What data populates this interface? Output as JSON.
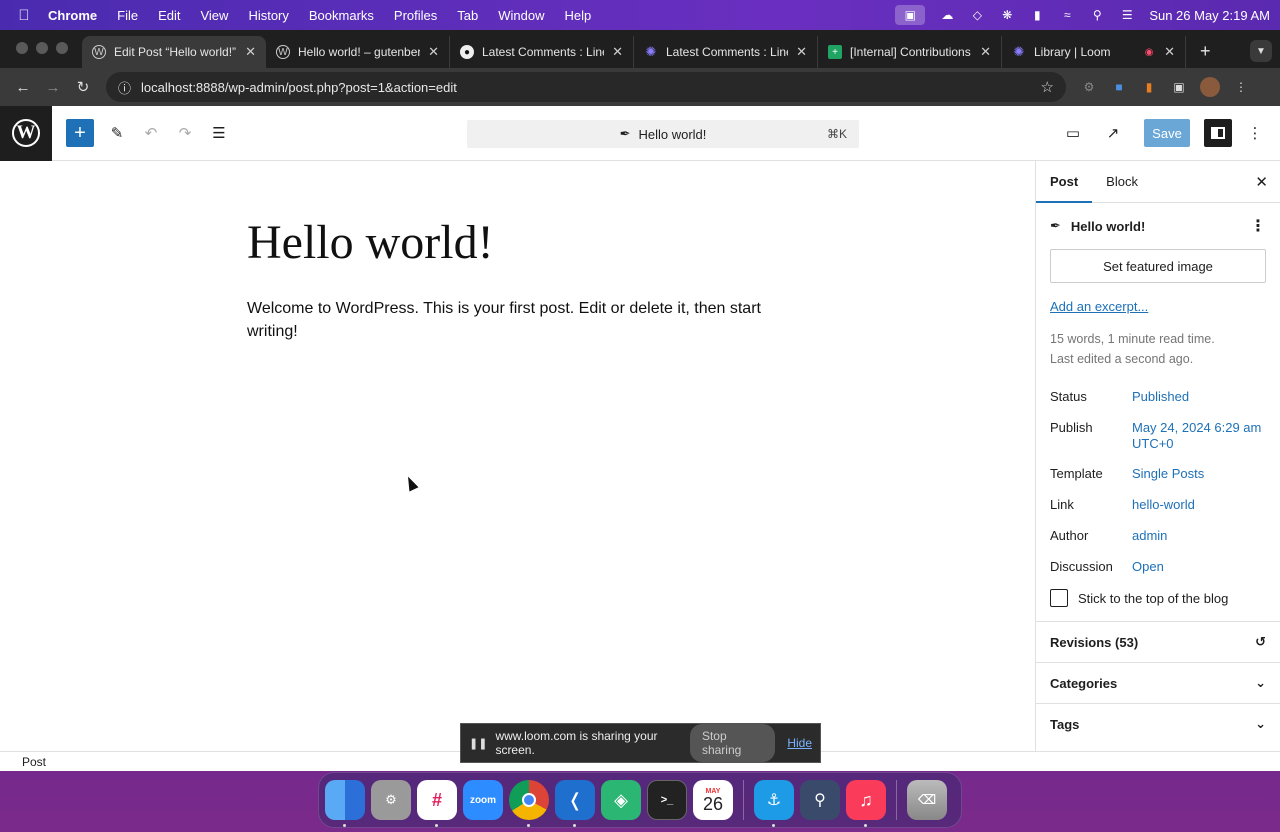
{
  "menubar": {
    "app": "Chrome",
    "items": [
      "File",
      "Edit",
      "View",
      "History",
      "Bookmarks",
      "Profiles",
      "Tab",
      "Window",
      "Help"
    ],
    "clock": "Sun 26 May  2:19 AM"
  },
  "tabs": [
    {
      "title": "Edit Post “Hello world!” ‹",
      "favicon": "wordpress-icon"
    },
    {
      "title": "Hello world! – gutenberg",
      "favicon": "wordpress-icon"
    },
    {
      "title": "Latest Comments : Line",
      "favicon": "github-icon"
    },
    {
      "title": "Latest Comments : Line",
      "favicon": "asterisk-icon"
    },
    {
      "title": "[Internal] Contributions",
      "favicon": "sheets-icon"
    },
    {
      "title": "Library | Loom",
      "favicon": "loom-icon"
    }
  ],
  "toolbar": {
    "url": "localhost:8888/wp-admin/post.php?post=1&action=edit"
  },
  "editor": {
    "command_title": "Hello world!",
    "shortcut": "⌘K",
    "save_label": "Save",
    "post_title": "Hello world!",
    "post_content": "Welcome to WordPress. This is your first post. Edit or delete it, then start writing!"
  },
  "sidebar": {
    "tab_post": "Post",
    "tab_block": "Block",
    "post_name": "Hello world!",
    "featured_image": "Set featured image",
    "excerpt_link": "Add an excerpt...",
    "word_count": "15 words, 1 minute read time.",
    "last_edited": "Last edited a second ago.",
    "fields": [
      {
        "label": "Status",
        "value": "Published"
      },
      {
        "label": "Publish",
        "value": "May 24, 2024 6:29 am UTC+0"
      },
      {
        "label": "Template",
        "value": "Single Posts"
      },
      {
        "label": "Link",
        "value": "hello-world"
      },
      {
        "label": "Author",
        "value": "admin"
      },
      {
        "label": "Discussion",
        "value": "Open"
      }
    ],
    "sticky_label": "Stick to the top of the blog",
    "revisions": "Revisions (53)",
    "categories": "Categories",
    "tags": "Tags"
  },
  "footer": {
    "breadcrumb": "Post"
  },
  "share_bar": {
    "message": "www.loom.com is sharing your screen.",
    "stop": "Stop sharing",
    "hide": "Hide"
  },
  "dock": {
    "calendar_month": "MAY",
    "calendar_day": "26",
    "zoom_label": "zoom"
  }
}
